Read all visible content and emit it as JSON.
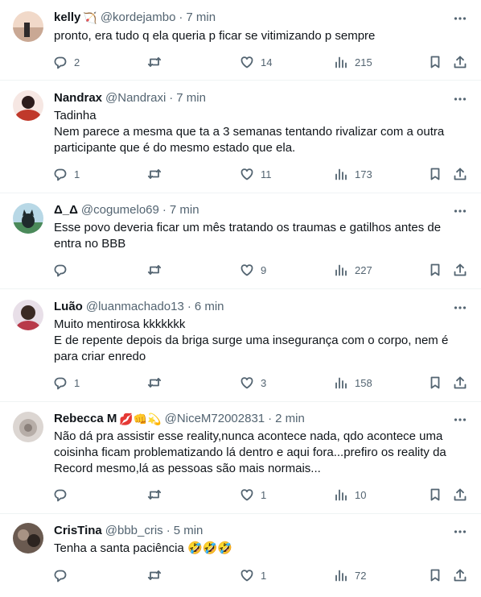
{
  "tweets": [
    {
      "name": "kelly",
      "badge": "🏹",
      "handle": "@kordejambo",
      "time": "7 min",
      "text": "pronto, era tudo q ela queria p ficar se vitimizando p sempre",
      "replies": "2",
      "retweets": "",
      "likes": "14",
      "views": "215",
      "avatar_colors": [
        "#f1d9c9",
        "#c9a894",
        "#2e2a2b"
      ]
    },
    {
      "name": "Nandrax",
      "badge": "",
      "handle": "@Nandraxi",
      "time": "7 min",
      "text": "Tadinha\nNem parece a mesma que ta a 3 semanas tentando rivalizar com a outra\nparticipante que é do mesmo estado que ela.",
      "replies": "1",
      "retweets": "",
      "likes": "11",
      "views": "173",
      "avatar_colors": [
        "#f6e7e3",
        "#c0392b",
        "#2b1b1b"
      ]
    },
    {
      "name": "Δ_Δ",
      "badge": "",
      "handle": "@cogumelo69",
      "time": "7 min",
      "text": "Esse povo deveria ficar um mês tratando os traumas e gatilhos antes de\nentra no BBB",
      "replies": "",
      "retweets": "",
      "likes": "9",
      "views": "227",
      "avatar_colors": [
        "#b8d8e6",
        "#4b8a5a",
        "#1f2a2c"
      ]
    },
    {
      "name": "Luão",
      "badge": "",
      "handle": "@luanmachado13",
      "time": "6 min",
      "text": "Muito mentirosa kkkkkkk\nE de repente depois da briga surge uma insegurança com o corpo, nem é\npara criar enredo",
      "replies": "1",
      "retweets": "",
      "likes": "3",
      "views": "158",
      "avatar_colors": [
        "#e8dfe8",
        "#b83a4a",
        "#3a2a24"
      ]
    },
    {
      "name": "Rebecca M",
      "badge": "💋👊💫",
      "handle": "@NiceM72002831",
      "time": "2 min",
      "text": "Não dá pra assistir esse reality,nunca acontece nada, qdo acontece uma\ncoisinha ficam problematizando lá dentro e aqui fora...prefiro os reality da\nRecord mesmo,lá as pessoas são mais normais...",
      "replies": "",
      "retweets": "",
      "likes": "1",
      "views": "10",
      "avatar_colors": [
        "#dcd6d2",
        "#b7aea8",
        "#8a807a"
      ]
    },
    {
      "name": "CrisTina",
      "badge": "",
      "handle": "@bbb_cris",
      "time": "5 min",
      "text": "Tenha a santa paciência 🤣🤣🤣",
      "replies": "",
      "retweets": "",
      "likes": "1",
      "views": "72",
      "avatar_colors": [
        "#6a5a50",
        "#a89384",
        "#2c2420"
      ]
    }
  ]
}
